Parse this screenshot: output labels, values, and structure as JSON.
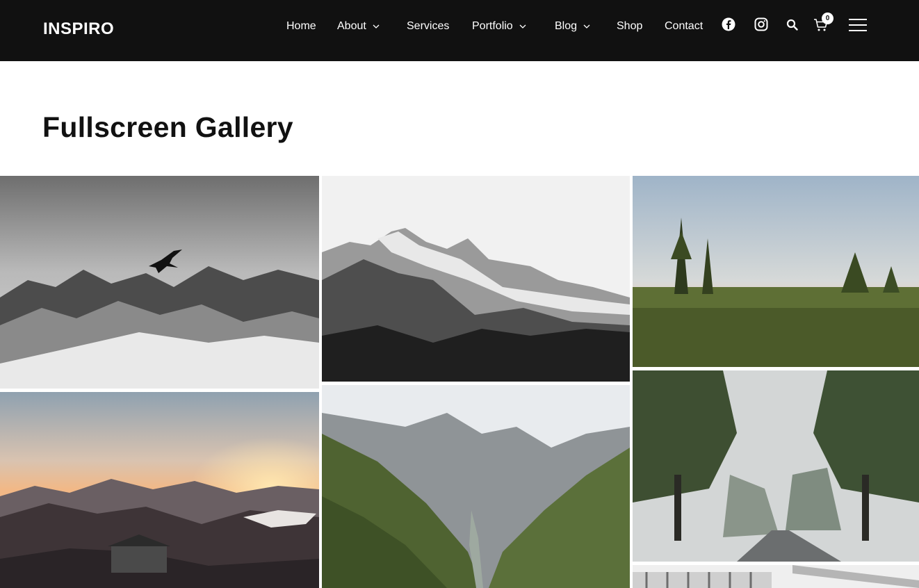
{
  "header": {
    "logo": "INSPIRO",
    "nav": {
      "home": "Home",
      "about": "About",
      "services": "Services",
      "portfolio": "Portfolio",
      "blog": "Blog",
      "shop": "Shop",
      "contact": "Contact"
    },
    "cart_count": "0",
    "icons": [
      "facebook-icon",
      "instagram-icon",
      "search-icon",
      "cart-icon",
      "hamburger-menu-icon",
      "chevron-down-icon"
    ]
  },
  "page": {
    "title": "Fullscreen Gallery"
  },
  "gallery": {
    "images": [
      "eagle-over-snowy-mountains",
      "snowy-mountain-peaks-in-fog",
      "meadow-with-pine-trees",
      "mountain-hut-at-sunset",
      "green-mountain-valley",
      "foggy-tree-lined-road",
      "white-building-facade"
    ]
  },
  "colors": {
    "header_bg": "#111111",
    "text_light": "#ffffff",
    "title": "#111111"
  }
}
